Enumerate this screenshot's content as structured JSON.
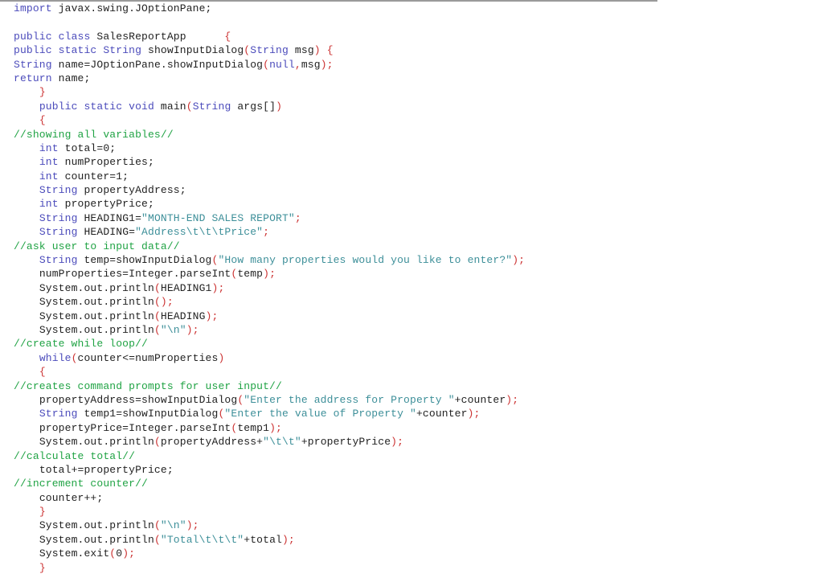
{
  "document": {
    "kind": "source-code-listing",
    "language": "Java",
    "class_name": "SalesReportApp",
    "colors": {
      "background": "#ffffff",
      "default_text": "#1a1a1a",
      "keyword": "#4b4bbb",
      "string": "#3d8f99",
      "punctuation": "#cc3333",
      "comment": "#20a344",
      "top_rule": "#9a9a9a"
    }
  },
  "code": {
    "lines": [
      {
        "indent": 0,
        "tokens": [
          {
            "t": "kw",
            "v": "import"
          },
          {
            "t": "plain",
            "v": " javax.swing.JOptionPane;"
          }
        ]
      },
      {
        "indent": 0,
        "tokens": []
      },
      {
        "indent": 0,
        "tokens": [
          {
            "t": "kw",
            "v": "public"
          },
          {
            "t": "plain",
            "v": " "
          },
          {
            "t": "kw",
            "v": "class"
          },
          {
            "t": "plain",
            "v": " SalesReportApp      "
          },
          {
            "t": "punc",
            "v": "{"
          }
        ]
      },
      {
        "indent": 0,
        "tokens": [
          {
            "t": "kw",
            "v": "public"
          },
          {
            "t": "plain",
            "v": " "
          },
          {
            "t": "kw",
            "v": "static"
          },
          {
            "t": "plain",
            "v": " "
          },
          {
            "t": "kw",
            "v": "String"
          },
          {
            "t": "plain",
            "v": " showInputDialog"
          },
          {
            "t": "punc",
            "v": "("
          },
          {
            "t": "kw",
            "v": "String"
          },
          {
            "t": "plain",
            "v": " msg"
          },
          {
            "t": "punc",
            "v": ")"
          },
          {
            "t": "plain",
            "v": " "
          },
          {
            "t": "punc",
            "v": "{"
          }
        ]
      },
      {
        "indent": 0,
        "tokens": [
          {
            "t": "kw",
            "v": "String"
          },
          {
            "t": "plain",
            "v": " name=JOptionPane.showInputDialog"
          },
          {
            "t": "punc",
            "v": "("
          },
          {
            "t": "kw",
            "v": "null"
          },
          {
            "t": "punc",
            "v": ","
          },
          {
            "t": "plain",
            "v": "msg"
          },
          {
            "t": "punc",
            "v": ");"
          }
        ]
      },
      {
        "indent": 0,
        "tokens": [
          {
            "t": "kw",
            "v": "return"
          },
          {
            "t": "plain",
            "v": " name;"
          }
        ]
      },
      {
        "indent": 1,
        "tokens": [
          {
            "t": "punc",
            "v": "}"
          }
        ]
      },
      {
        "indent": 1,
        "tokens": [
          {
            "t": "kw",
            "v": "public"
          },
          {
            "t": "plain",
            "v": " "
          },
          {
            "t": "kw",
            "v": "static"
          },
          {
            "t": "plain",
            "v": " "
          },
          {
            "t": "kw",
            "v": "void"
          },
          {
            "t": "plain",
            "v": " main"
          },
          {
            "t": "punc",
            "v": "("
          },
          {
            "t": "kw",
            "v": "String"
          },
          {
            "t": "plain",
            "v": " args[]"
          },
          {
            "t": "punc",
            "v": ")"
          }
        ]
      },
      {
        "indent": 1,
        "tokens": [
          {
            "t": "punc",
            "v": "{"
          }
        ]
      },
      {
        "indent": 0,
        "tokens": [
          {
            "t": "cmt",
            "v": "//showing all variables//"
          }
        ]
      },
      {
        "indent": 1,
        "tokens": [
          {
            "t": "kw",
            "v": "int"
          },
          {
            "t": "plain",
            "v": " total=0;"
          }
        ]
      },
      {
        "indent": 1,
        "tokens": [
          {
            "t": "kw",
            "v": "int"
          },
          {
            "t": "plain",
            "v": " numProperties;"
          }
        ]
      },
      {
        "indent": 1,
        "tokens": [
          {
            "t": "kw",
            "v": "int"
          },
          {
            "t": "plain",
            "v": " counter=1;"
          }
        ]
      },
      {
        "indent": 1,
        "tokens": [
          {
            "t": "kw",
            "v": "String"
          },
          {
            "t": "plain",
            "v": " propertyAddress;"
          }
        ]
      },
      {
        "indent": 1,
        "tokens": [
          {
            "t": "kw",
            "v": "int"
          },
          {
            "t": "plain",
            "v": " propertyPrice;"
          }
        ]
      },
      {
        "indent": 1,
        "tokens": [
          {
            "t": "kw",
            "v": "String"
          },
          {
            "t": "plain",
            "v": " HEADING1="
          },
          {
            "t": "str",
            "v": "\"MONTH-END SALES REPORT\""
          },
          {
            "t": "punc",
            "v": ";"
          }
        ]
      },
      {
        "indent": 1,
        "tokens": [
          {
            "t": "kw",
            "v": "String"
          },
          {
            "t": "plain",
            "v": " HEADING="
          },
          {
            "t": "str",
            "v": "\"Address\\t\\t\\tPrice\""
          },
          {
            "t": "punc",
            "v": ";"
          }
        ]
      },
      {
        "indent": 0,
        "tokens": [
          {
            "t": "cmt",
            "v": "//ask user to input data//"
          }
        ]
      },
      {
        "indent": 1,
        "tokens": [
          {
            "t": "kw",
            "v": "String"
          },
          {
            "t": "plain",
            "v": " temp=showInputDialog"
          },
          {
            "t": "punc",
            "v": "("
          },
          {
            "t": "str",
            "v": "\"How many properties would you like to enter?\""
          },
          {
            "t": "punc",
            "v": ");"
          }
        ]
      },
      {
        "indent": 1,
        "tokens": [
          {
            "t": "plain",
            "v": "numProperties=Integer.parseInt"
          },
          {
            "t": "punc",
            "v": "("
          },
          {
            "t": "plain",
            "v": "temp"
          },
          {
            "t": "punc",
            "v": ");"
          }
        ]
      },
      {
        "indent": 1,
        "tokens": [
          {
            "t": "plain",
            "v": "System.out.println"
          },
          {
            "t": "punc",
            "v": "("
          },
          {
            "t": "plain",
            "v": "HEADING1"
          },
          {
            "t": "punc",
            "v": ");"
          }
        ]
      },
      {
        "indent": 1,
        "tokens": [
          {
            "t": "plain",
            "v": "System.out.println"
          },
          {
            "t": "punc",
            "v": "();"
          }
        ]
      },
      {
        "indent": 1,
        "tokens": [
          {
            "t": "plain",
            "v": "System.out.println"
          },
          {
            "t": "punc",
            "v": "("
          },
          {
            "t": "plain",
            "v": "HEADING"
          },
          {
            "t": "punc",
            "v": ");"
          }
        ]
      },
      {
        "indent": 1,
        "tokens": [
          {
            "t": "plain",
            "v": "System.out.println"
          },
          {
            "t": "punc",
            "v": "("
          },
          {
            "t": "str",
            "v": "\"\\n\""
          },
          {
            "t": "punc",
            "v": ");"
          }
        ]
      },
      {
        "indent": 0,
        "tokens": [
          {
            "t": "cmt",
            "v": "//create while loop//"
          }
        ]
      },
      {
        "indent": 1,
        "tokens": [
          {
            "t": "kw",
            "v": "while"
          },
          {
            "t": "punc",
            "v": "("
          },
          {
            "t": "plain",
            "v": "counter<=numProperties"
          },
          {
            "t": "punc",
            "v": ")"
          }
        ]
      },
      {
        "indent": 1,
        "tokens": [
          {
            "t": "punc",
            "v": "{"
          }
        ]
      },
      {
        "indent": 0,
        "tokens": [
          {
            "t": "cmt",
            "v": "//creates command prompts for user input//"
          }
        ]
      },
      {
        "indent": 1,
        "tokens": [
          {
            "t": "plain",
            "v": "propertyAddress=showInputDialog"
          },
          {
            "t": "punc",
            "v": "("
          },
          {
            "t": "str",
            "v": "\"Enter the address for Property \""
          },
          {
            "t": "plain",
            "v": "+counter"
          },
          {
            "t": "punc",
            "v": ");"
          }
        ]
      },
      {
        "indent": 1,
        "tokens": [
          {
            "t": "kw",
            "v": "String"
          },
          {
            "t": "plain",
            "v": " temp1=showInputDialog"
          },
          {
            "t": "punc",
            "v": "("
          },
          {
            "t": "str",
            "v": "\"Enter the value of Property \""
          },
          {
            "t": "plain",
            "v": "+counter"
          },
          {
            "t": "punc",
            "v": ");"
          }
        ]
      },
      {
        "indent": 1,
        "tokens": [
          {
            "t": "plain",
            "v": "propertyPrice=Integer.parseInt"
          },
          {
            "t": "punc",
            "v": "("
          },
          {
            "t": "plain",
            "v": "temp1"
          },
          {
            "t": "punc",
            "v": ");"
          }
        ]
      },
      {
        "indent": 1,
        "tokens": [
          {
            "t": "plain",
            "v": "System.out.println"
          },
          {
            "t": "punc",
            "v": "("
          },
          {
            "t": "plain",
            "v": "propertyAddress+"
          },
          {
            "t": "str",
            "v": "\"\\t\\t\""
          },
          {
            "t": "plain",
            "v": "+propertyPrice"
          },
          {
            "t": "punc",
            "v": ");"
          }
        ]
      },
      {
        "indent": 0,
        "tokens": [
          {
            "t": "cmt",
            "v": "//calculate total//"
          }
        ]
      },
      {
        "indent": 1,
        "tokens": [
          {
            "t": "plain",
            "v": "total+=propertyPrice;"
          }
        ]
      },
      {
        "indent": 0,
        "tokens": [
          {
            "t": "cmt",
            "v": "//increment counter//"
          }
        ]
      },
      {
        "indent": 1,
        "tokens": [
          {
            "t": "plain",
            "v": "counter++;"
          }
        ]
      },
      {
        "indent": 1,
        "tokens": [
          {
            "t": "punc",
            "v": "}"
          }
        ]
      },
      {
        "indent": 1,
        "tokens": [
          {
            "t": "plain",
            "v": "System.out.println"
          },
          {
            "t": "punc",
            "v": "("
          },
          {
            "t": "str",
            "v": "\"\\n\""
          },
          {
            "t": "punc",
            "v": ");"
          }
        ]
      },
      {
        "indent": 1,
        "tokens": [
          {
            "t": "plain",
            "v": "System.out.println"
          },
          {
            "t": "punc",
            "v": "("
          },
          {
            "t": "str",
            "v": "\"Total\\t\\t\\t\""
          },
          {
            "t": "plain",
            "v": "+total"
          },
          {
            "t": "punc",
            "v": ");"
          }
        ]
      },
      {
        "indent": 1,
        "tokens": [
          {
            "t": "plain",
            "v": "System.exit"
          },
          {
            "t": "punc",
            "v": "("
          },
          {
            "t": "plain",
            "v": "0"
          },
          {
            "t": "punc",
            "v": ");"
          }
        ]
      },
      {
        "indent": 1,
        "tokens": [
          {
            "t": "punc",
            "v": "}"
          }
        ]
      }
    ]
  }
}
